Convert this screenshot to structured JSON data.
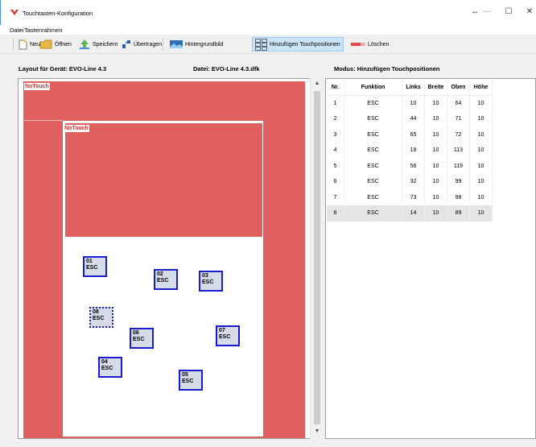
{
  "window": {
    "title": "Touchtasten-Konfiguration",
    "btn_minimize": "—",
    "btn_maximize": "☐",
    "btn_close": "✕",
    "btn_resize": "↔"
  },
  "menu": [
    "Datei",
    "Tastenrahmen"
  ],
  "toolbar": {
    "new": "Neu",
    "open": "Öffnen",
    "save": "Speichern",
    "transfer": "Übertragen",
    "background": "Hintergrundbild",
    "add_touch": "Hinzufügen Touchpositionen",
    "delete": "Löschen"
  },
  "info": {
    "layout": "Layout für Gerät: EVO-Line 4.3",
    "file": "Datei: EVO-Line 4.3.dfk",
    "mode": "Modus: Hinzufügen Touchpositionen"
  },
  "canvas": {
    "notouch_outer": "NoTouch",
    "notouch_inner": "NoTouch",
    "boxes": [
      {
        "id": "01",
        "func": "ESC"
      },
      {
        "id": "02",
        "func": "ESC"
      },
      {
        "id": "03",
        "func": "ESC"
      },
      {
        "id": "08",
        "func": "ESC"
      },
      {
        "id": "06",
        "func": "ESC"
      },
      {
        "id": "07",
        "func": "ESC"
      },
      {
        "id": "04",
        "func": "ESC"
      },
      {
        "id": "05",
        "func": "ESC"
      }
    ]
  },
  "table": {
    "headers": [
      "Nr.",
      "Funktion",
      "Links",
      "Breite",
      "Oben",
      "Höhe"
    ],
    "rows": [
      [
        "1",
        "ESC",
        "10",
        "10",
        "64",
        "10"
      ],
      [
        "2",
        "ESC",
        "44",
        "10",
        "71",
        "10"
      ],
      [
        "3",
        "ESC",
        "65",
        "10",
        "72",
        "10"
      ],
      [
        "4",
        "ESC",
        "18",
        "10",
        "113",
        "10"
      ],
      [
        "5",
        "ESC",
        "56",
        "10",
        "119",
        "10"
      ],
      [
        "6",
        "ESC",
        "32",
        "10",
        "99",
        "10"
      ],
      [
        "7",
        "ESC",
        "73",
        "10",
        "98",
        "10"
      ],
      [
        "8",
        "ESC",
        "14",
        "10",
        "89",
        "10"
      ]
    ],
    "selected_row": 8
  },
  "scrollbar": {
    "up": "▲",
    "down": "▼"
  },
  "colors": {
    "notouch": "#e06060",
    "touch_border": "#1b1bd0",
    "selection": "#cce4f7"
  }
}
